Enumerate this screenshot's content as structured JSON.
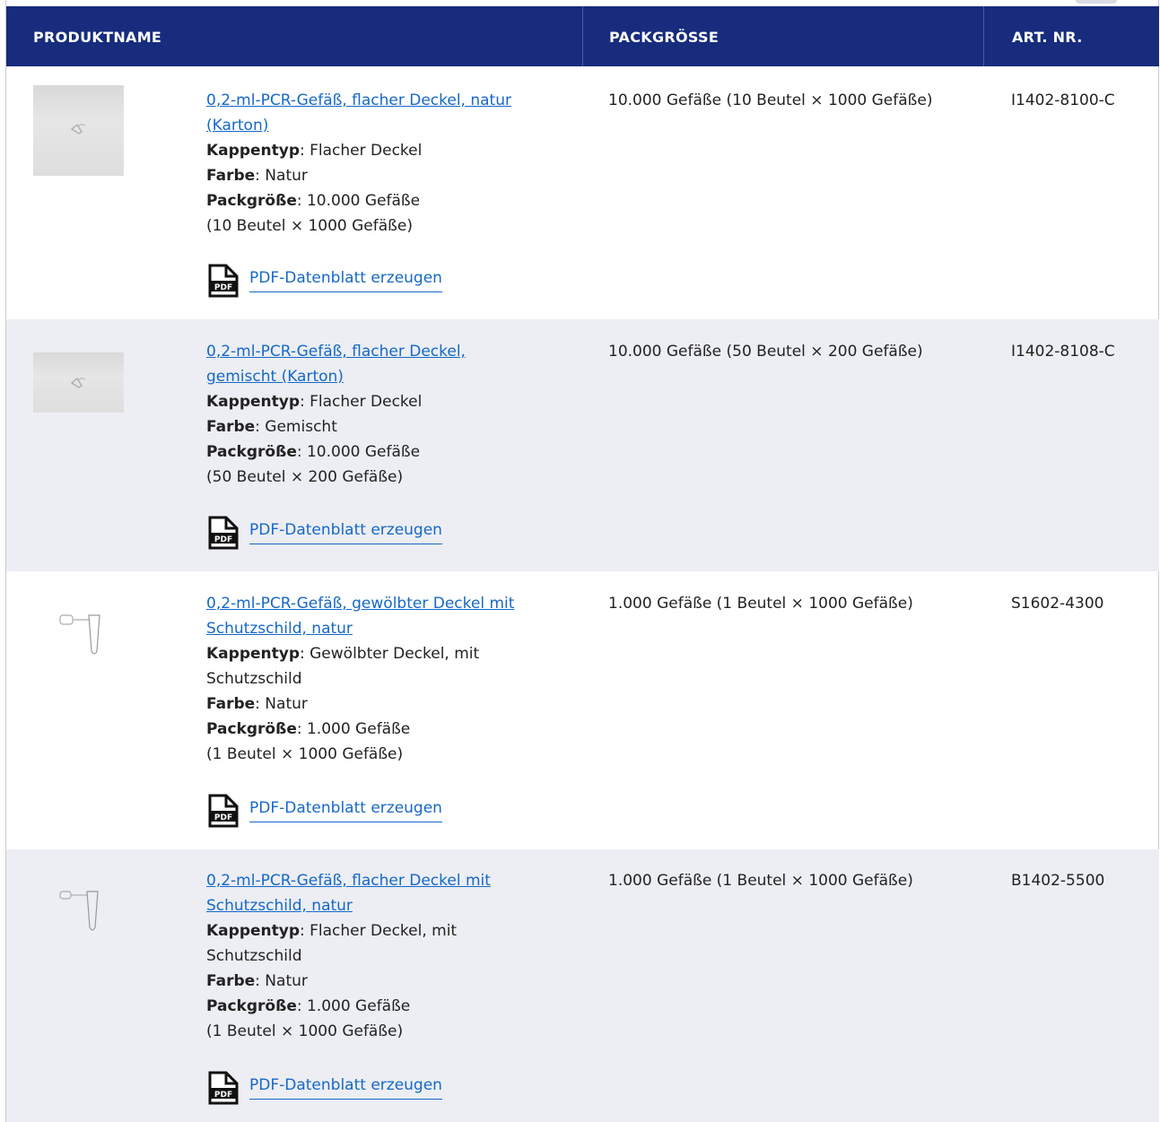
{
  "table": {
    "headers": {
      "product_name": "PRODUKTNAME",
      "pack_size": "PACKGRÖSSE",
      "article_no": "ART. NR."
    },
    "pdf_label": "PDF-Datenblatt erzeugen",
    "pdf_icon_text": "PDF",
    "rows": [
      {
        "name_line1": "0,2-ml-PCR-Gefäß, flacher Deckel, natur",
        "name_line2": "(Karton)",
        "cap_label": "Kappentyp",
        "cap_value": ": Flacher Deckel",
        "cap_value2": "",
        "color_label": "Farbe",
        "color_value": ": Natur",
        "pack_label": "Packgröße",
        "pack_value": ": 10.000 Gefäße",
        "pack_value2": "(10 Beutel × 1000 Gefäße)",
        "pack_size": "10.000 Gefäße (10 Beutel × 1000 Gefäße)",
        "article_no": "I1402-8100-C"
      },
      {
        "name_line1": "0,2-ml-PCR-Gefäß, flacher Deckel,",
        "name_line2": "gemischt (Karton)",
        "cap_label": "Kappentyp",
        "cap_value": ": Flacher Deckel",
        "cap_value2": "",
        "color_label": "Farbe",
        "color_value": ": Gemischt",
        "pack_label": "Packgröße",
        "pack_value": ": 10.000 Gefäße",
        "pack_value2": "(50 Beutel × 200 Gefäße)",
        "pack_size": "10.000 Gefäße (50 Beutel × 200 Gefäße)",
        "article_no": "I1402-8108-C"
      },
      {
        "name_line1": "0,2-ml-PCR-Gefäß, gewölbter Deckel mit",
        "name_line2": "Schutzschild, natur",
        "cap_label": "Kappentyp",
        "cap_value": ": Gewölbter Deckel, mit",
        "cap_value2": "Schutzschild",
        "color_label": "Farbe",
        "color_value": ": Natur",
        "pack_label": "Packgröße",
        "pack_value": ": 1.000 Gefäße",
        "pack_value2": "(1 Beutel × 1000 Gefäße)",
        "pack_size": "1.000 Gefäße (1 Beutel × 1000 Gefäße)",
        "article_no": "S1602-4300"
      },
      {
        "name_line1": "0,2-ml-PCR-Gefäß, flacher Deckel mit",
        "name_line2": "Schutzschild, natur",
        "cap_label": "Kappentyp",
        "cap_value": ": Flacher Deckel, mit",
        "cap_value2": "Schutzschild",
        "color_label": "Farbe",
        "color_value": ": Natur",
        "pack_label": "Packgröße",
        "pack_value": ": 1.000 Gefäße",
        "pack_value2": "(1 Beutel × 1000 Gefäße)",
        "pack_size": "1.000 Gefäße (1 Beutel × 1000 Gefäße)",
        "article_no": "B1402-5500"
      }
    ]
  },
  "colors": {
    "header_bg": "#172c7d",
    "link": "#1668c9",
    "row_alt_bg": "#eceef3"
  }
}
